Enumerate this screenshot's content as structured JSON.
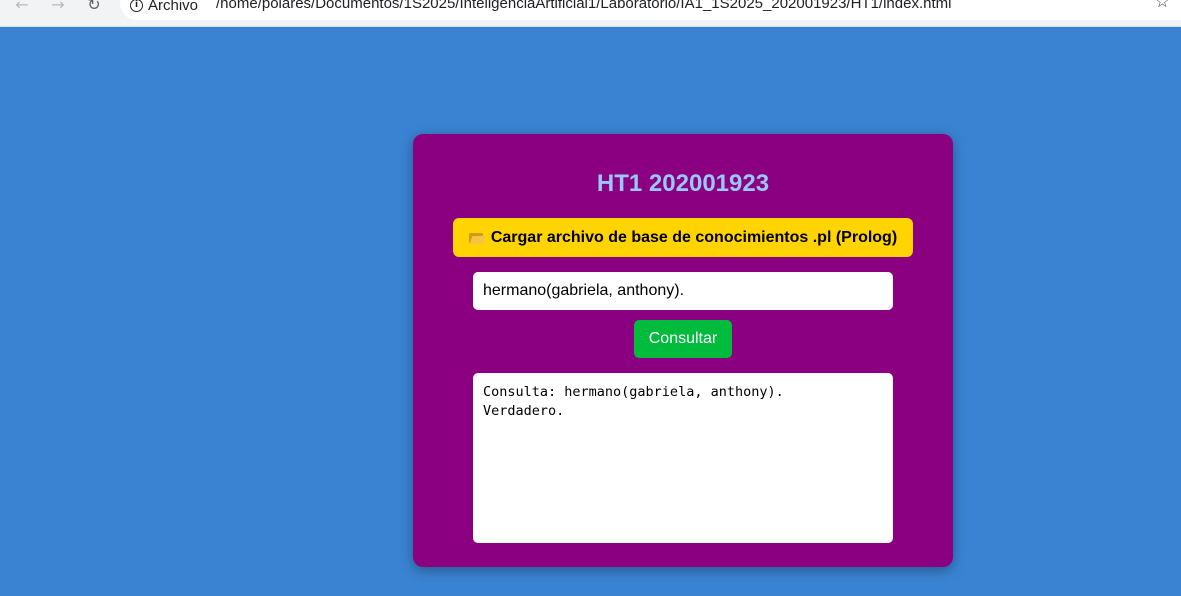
{
  "browser": {
    "site_chip_label": "Archivo",
    "url": "/home/polares/Documentos/1S2025/InteligenciaArtificial1/Laboratorio/IA1_1S2025_202001923/HT1/index.html",
    "icons": {
      "back": "arrow-left-icon",
      "forward": "arrow-right-icon",
      "reload": "reload-icon",
      "info": "info-icon",
      "bookmark": "star-icon"
    }
  },
  "page": {
    "background_color": "#3a83d2",
    "card_color": "#8b0080",
    "title": "HT1 202001923",
    "load_button": {
      "icon": "open-folder-icon",
      "label": "Cargar archivo de base de conocimientos .pl (Prolog)",
      "color": "#ffd400"
    },
    "query_input": {
      "value": "hermano(gabriela, anthony)."
    },
    "consult_button": {
      "label": "Consultar",
      "color": "#00bb3c"
    },
    "output": {
      "lines": [
        "Consulta: hermano(gabriela, anthony).",
        "Verdadero."
      ]
    }
  }
}
